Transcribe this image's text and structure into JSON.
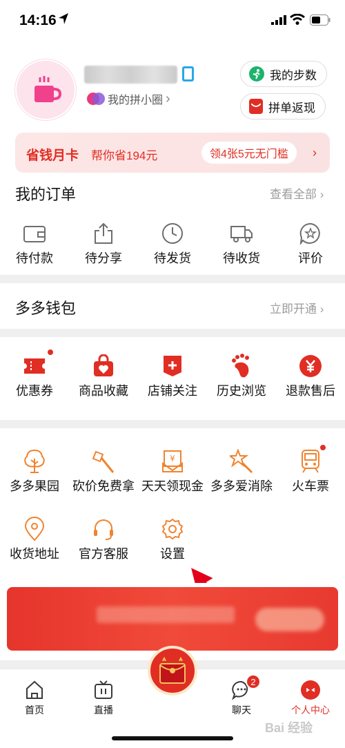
{
  "status_bar": {
    "time": "14:16"
  },
  "profile": {
    "circle_label": "我的拼小圈",
    "chevron": "›",
    "steps_label": "我的步数",
    "cashback_label": "拼单返现"
  },
  "money_card": {
    "title": "省钱月卡",
    "subtitle": "帮你省194元",
    "button": "领4张5元无门槛",
    "arrow": "›"
  },
  "orders": {
    "title": "我的订单",
    "link": "查看全部 ›",
    "items": [
      {
        "label": "待付款",
        "icon": "wallet-icon"
      },
      {
        "label": "待分享",
        "icon": "share-icon"
      },
      {
        "label": "待发货",
        "icon": "clock-icon"
      },
      {
        "label": "待收货",
        "icon": "truck-icon"
      },
      {
        "label": "评价",
        "icon": "review-icon"
      }
    ]
  },
  "wallet": {
    "title": "多多钱包",
    "link": "立即开通 ›"
  },
  "shortcuts": {
    "items": [
      {
        "label": "优惠券",
        "icon": "coupon-icon"
      },
      {
        "label": "商品收藏",
        "icon": "favorites-icon"
      },
      {
        "label": "店铺关注",
        "icon": "store-follow-icon"
      },
      {
        "label": "历史浏览",
        "icon": "footprint-icon"
      },
      {
        "label": "退款售后",
        "icon": "refund-icon"
      }
    ]
  },
  "services": {
    "row1": [
      {
        "label": "多多果园",
        "icon": "tree-icon"
      },
      {
        "label": "砍价免费拿",
        "icon": "axe-icon"
      },
      {
        "label": "天天领现金",
        "icon": "cash-icon"
      },
      {
        "label": "多多爱消除",
        "icon": "star-wand-icon"
      },
      {
        "label": "火车票",
        "icon": "train-icon"
      }
    ],
    "row2": [
      {
        "label": "收货地址",
        "icon": "location-icon"
      },
      {
        "label": "官方客服",
        "icon": "headset-icon"
      },
      {
        "label": "设置",
        "icon": "settings-gear-icon"
      }
    ]
  },
  "tabbar": {
    "home": "首页",
    "live": "直播",
    "chat": "聊天",
    "chat_badge": "2",
    "profile": "个人中心"
  },
  "watermark": "Bai 经验",
  "colors": {
    "brand_red": "#e02e24",
    "orange": "#f0832f",
    "link_gray": "#9c9c9c"
  }
}
